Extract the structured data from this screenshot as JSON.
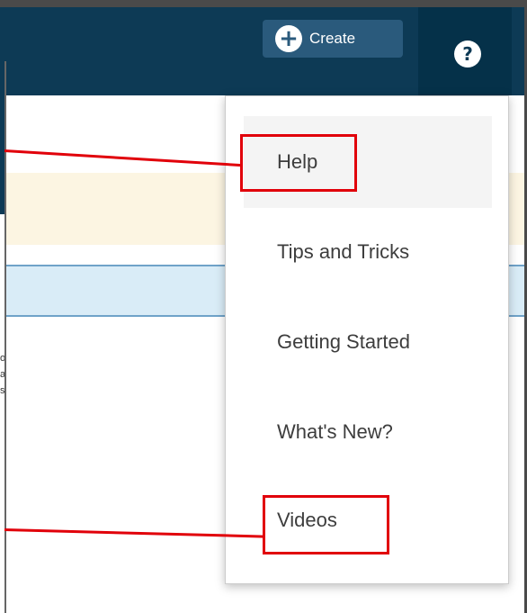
{
  "header": {
    "create_label": "Create",
    "create_icon": "plus-circle-icon",
    "help_icon": "question-mark-icon",
    "help_symbol": "?"
  },
  "help_menu": {
    "items": [
      {
        "label": "Help"
      },
      {
        "label": "Tips and Tricks"
      },
      {
        "label": "Getting Started"
      },
      {
        "label": "What's New?"
      },
      {
        "label": "Videos"
      }
    ],
    "highlighted": [
      "Help",
      "Videos"
    ]
  },
  "colors": {
    "nav_bar": "#0d3a55",
    "help_zone": "#053149",
    "create_button": "#2a5a7c",
    "highlight": "#e1000a",
    "yellow_banner": "#fcf5e2",
    "blue_banner": "#d9ecf7"
  },
  "left_panel": {
    "fragments": [
      "o",
      "a",
      "s"
    ]
  }
}
